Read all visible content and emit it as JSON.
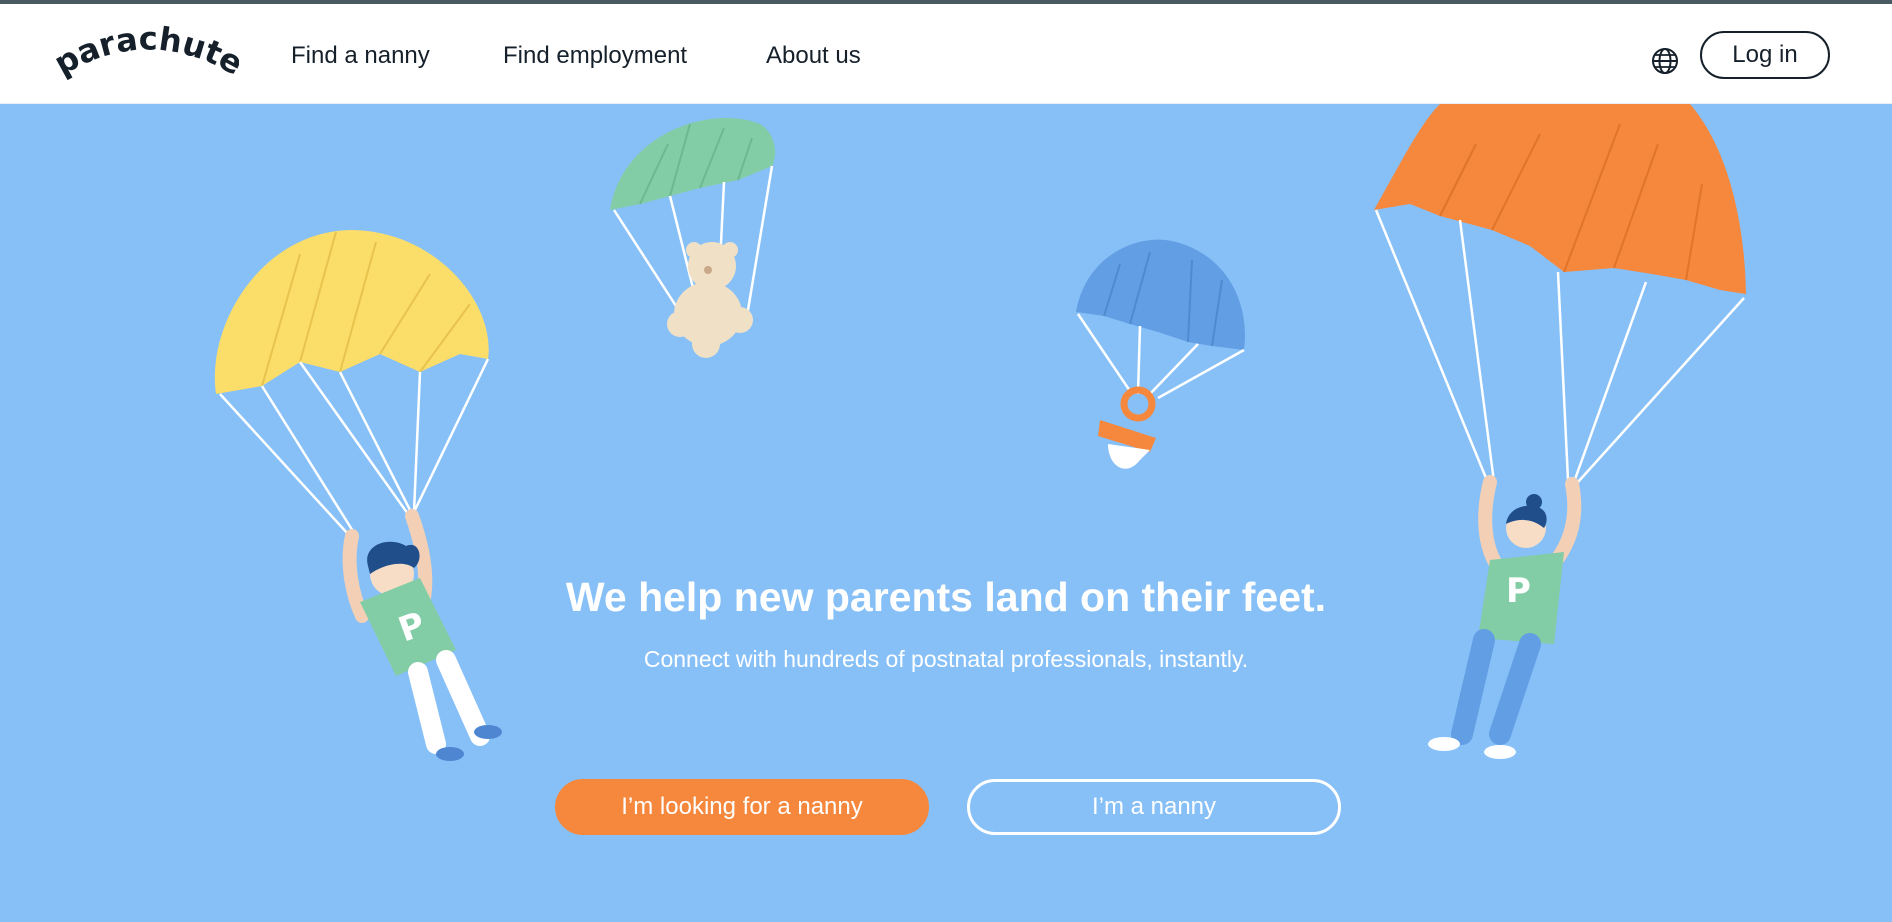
{
  "brand": {
    "logo_text": "parachute"
  },
  "nav": {
    "links": [
      {
        "label": "Find a nanny"
      },
      {
        "label": "Find employment"
      },
      {
        "label": "About us"
      }
    ],
    "language_icon": "globe-icon",
    "login_label": "Log in"
  },
  "hero": {
    "title": "We help new parents land on their feet.",
    "subtitle": "Connect with hundreds of postnatal professionals, instantly.",
    "primary_cta": "I’m looking for a nanny",
    "secondary_cta": "I’m a nanny",
    "shirt_letter": "P"
  },
  "colors": {
    "hero_background": "#87c0f7",
    "accent_orange": "#f5883c",
    "parachute_yellow": "#fbdd6a",
    "parachute_green": "#82cda5",
    "parachute_blue": "#629ee4",
    "parachute_orange": "#f5883c",
    "text_dark": "#15202b"
  }
}
